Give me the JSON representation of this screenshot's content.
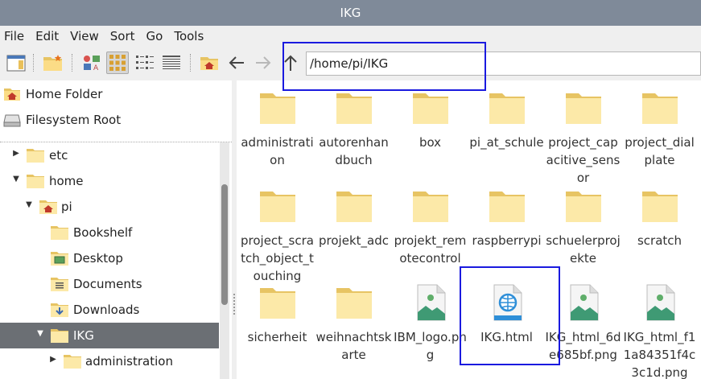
{
  "window": {
    "title": "IKG"
  },
  "menu": [
    "File",
    "Edit",
    "View",
    "Sort",
    "Go",
    "Tools"
  ],
  "toolbar": {
    "buttons": [
      {
        "name": "new-window-icon"
      },
      {
        "name": "new-folder-icon"
      },
      {
        "name": "icon-view-icon"
      },
      {
        "name": "thumbnail-view-icon",
        "active": true
      },
      {
        "name": "compact-view-icon"
      },
      {
        "name": "detailed-list-icon"
      },
      {
        "name": "home-icon"
      },
      {
        "name": "back-arrow-icon"
      },
      {
        "name": "forward-arrow-icon"
      },
      {
        "name": "up-arrow-icon"
      }
    ],
    "path": "/home/pi/IKG"
  },
  "places": [
    {
      "label": "Home Folder",
      "icon": "home-folder-icon"
    },
    {
      "label": "Filesystem Root",
      "icon": "drive-icon"
    }
  ],
  "tree": [
    {
      "label": "etc",
      "expander": "▶"
    },
    {
      "label": "home",
      "expander": "▼"
    },
    {
      "label": "pi",
      "expander": "▼"
    },
    {
      "label": "Bookshelf",
      "expander": ""
    },
    {
      "label": "Desktop",
      "expander": ""
    },
    {
      "label": "Documents",
      "expander": ""
    },
    {
      "label": "Downloads",
      "expander": ""
    },
    {
      "label": "IKG",
      "expander": "▼",
      "selected": true
    },
    {
      "label": "administration",
      "expander": "▶"
    }
  ],
  "files": [
    {
      "name": "administration",
      "type": "folder"
    },
    {
      "name": "autorenhandbuch",
      "type": "folder"
    },
    {
      "name": "box",
      "type": "folder"
    },
    {
      "name": "pi_at_schule",
      "type": "folder"
    },
    {
      "name": "project_capacitive_sensor",
      "type": "folder"
    },
    {
      "name": "project_dialplate",
      "type": "folder"
    },
    {
      "name": "project_scratch_object_touching",
      "type": "folder"
    },
    {
      "name": "projekt_adc",
      "type": "folder"
    },
    {
      "name": "projekt_remotecontrol",
      "type": "folder"
    },
    {
      "name": "raspberrypi",
      "type": "folder"
    },
    {
      "name": "schuelerprojekte",
      "type": "folder"
    },
    {
      "name": "scratch",
      "type": "folder"
    },
    {
      "name": "sicherheit",
      "type": "folder"
    },
    {
      "name": "weihnachtskarte",
      "type": "folder"
    },
    {
      "name": "IBM_logo.png",
      "type": "image"
    },
    {
      "name": "IKG.html",
      "type": "html"
    },
    {
      "name": "IKG_html_6de685bf.png",
      "type": "image"
    },
    {
      "name": "IKG_html_f11a84351f4c3c1d.png",
      "type": "image"
    }
  ],
  "colors": {
    "titlebar": "#7f8a99",
    "highlight_box": "#1a1adf",
    "selected_row": "#6b6f74",
    "folder": "#fce9a8"
  }
}
